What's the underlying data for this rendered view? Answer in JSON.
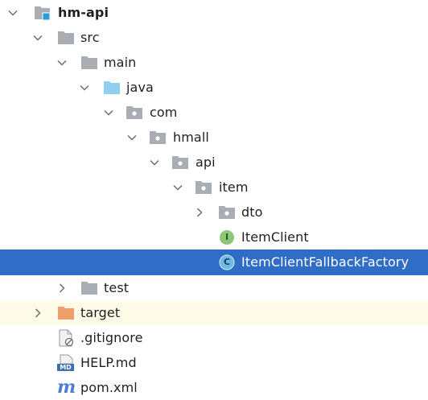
{
  "colors": {
    "selection": "#2f6dc7",
    "ignored_row": "#fdfbe8",
    "folder": "#a9aeb5",
    "source_folder": "#8fd0ef",
    "excluded_folder": "#ef9d6a",
    "module_badge": "#2e9bd9",
    "interface_icon": "#8cc878",
    "class_icon": "#47a8d8"
  },
  "tree": [
    {
      "label": "hm-api",
      "icon": "module-folder-icon",
      "expanded": true
    },
    {
      "label": "src",
      "icon": "folder-icon",
      "expanded": true
    },
    {
      "label": "main",
      "icon": "folder-icon",
      "expanded": true
    },
    {
      "label": "java",
      "icon": "source-folder-icon",
      "expanded": true
    },
    {
      "label": "com",
      "icon": "package-icon",
      "expanded": true
    },
    {
      "label": "hmall",
      "icon": "package-icon",
      "expanded": true
    },
    {
      "label": "api",
      "icon": "package-icon",
      "expanded": true
    },
    {
      "label": "item",
      "icon": "package-icon",
      "expanded": true
    },
    {
      "label": "dto",
      "icon": "package-icon",
      "expanded": false
    },
    {
      "label": "ItemClient",
      "icon": "interface-icon",
      "icon_letter": "I"
    },
    {
      "label": "ItemClientFallbackFactory",
      "icon": "class-icon",
      "icon_letter": "C",
      "selected": true
    },
    {
      "label": "test",
      "icon": "folder-icon",
      "expanded": false
    },
    {
      "label": "target",
      "icon": "excluded-folder-icon",
      "expanded": false
    },
    {
      "label": ".gitignore",
      "icon": "gitignore-file-icon"
    },
    {
      "label": "HELP.md",
      "icon": "markdown-file-icon",
      "icon_letter": "MD"
    },
    {
      "label": "pom.xml",
      "icon": "maven-file-icon",
      "icon_letter": "m"
    }
  ]
}
